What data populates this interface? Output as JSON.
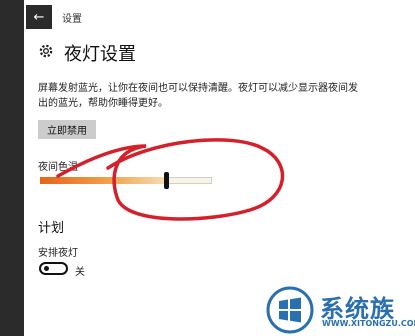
{
  "titlebar": {
    "back_icon": "back-arrow-icon",
    "title": "设置"
  },
  "header": {
    "icon": "gear-icon",
    "title": "夜灯设置"
  },
  "description": "屏幕发射蓝光，让你在夜间也可以保持清醒。夜灯可以减少显示器夜间发出的蓝光，帮助你睡得更好。",
  "disable_button": {
    "label": "立即禁用"
  },
  "color_temperature": {
    "label": "夜间色温",
    "value": 0.73
  },
  "schedule": {
    "title": "计划",
    "toggle_label": "安排夜灯",
    "toggle_state": "关",
    "is_on": false
  },
  "watermark": {
    "name": "系统族",
    "url": "WWW.XITONGZU.COM"
  },
  "colors": {
    "accent_orange": "#e8621a",
    "annotation_red": "#d3202a",
    "logo_blue": "#2a6fb0"
  }
}
